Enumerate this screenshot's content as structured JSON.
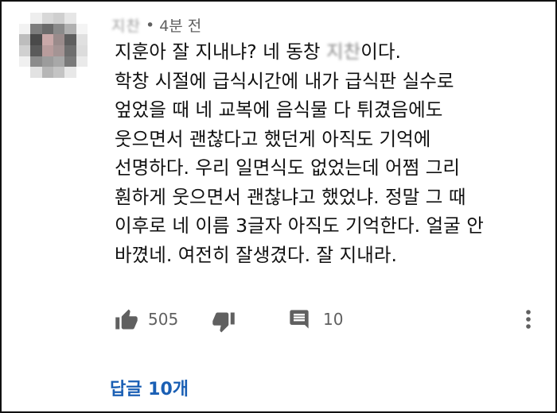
{
  "comment": {
    "author": "지찬",
    "separator": "•",
    "time": "4분 전",
    "lines": [
      {
        "before": "지훈아 잘 지내냐? 네 동창 ",
        "name": "지찬",
        "after": "이다."
      },
      "학창 시절에 급식시간에 내가 급식판 실수로",
      "엎었을 때 네 교복에 음식물 다 튀겼음에도",
      "웃으면서 괜찮다고 했던게 아직도 기억에",
      "선명하다. 우리 일면식도 없었는데 어쩜 그리",
      "훤하게 웃으면서 괜찮냐고 했었냐. 정말 그 때",
      "이후로 네 이름 3글자 아직도 기억한다. 얼굴 안",
      "바꼈네. 여전히 잘생겼다. 잘 지내라."
    ]
  },
  "actions": {
    "like_icon": "thumbs-up-icon",
    "like_count": "505",
    "dislike_icon": "thumbs-down-icon",
    "reply_icon": "comment-icon",
    "reply_count": "10",
    "more_icon": "more-vertical-icon"
  },
  "replies_link": "답글 10개",
  "colors": {
    "text": "#111111",
    "meta": "#606060",
    "link": "#1a5fb4",
    "icon": "#606060"
  }
}
